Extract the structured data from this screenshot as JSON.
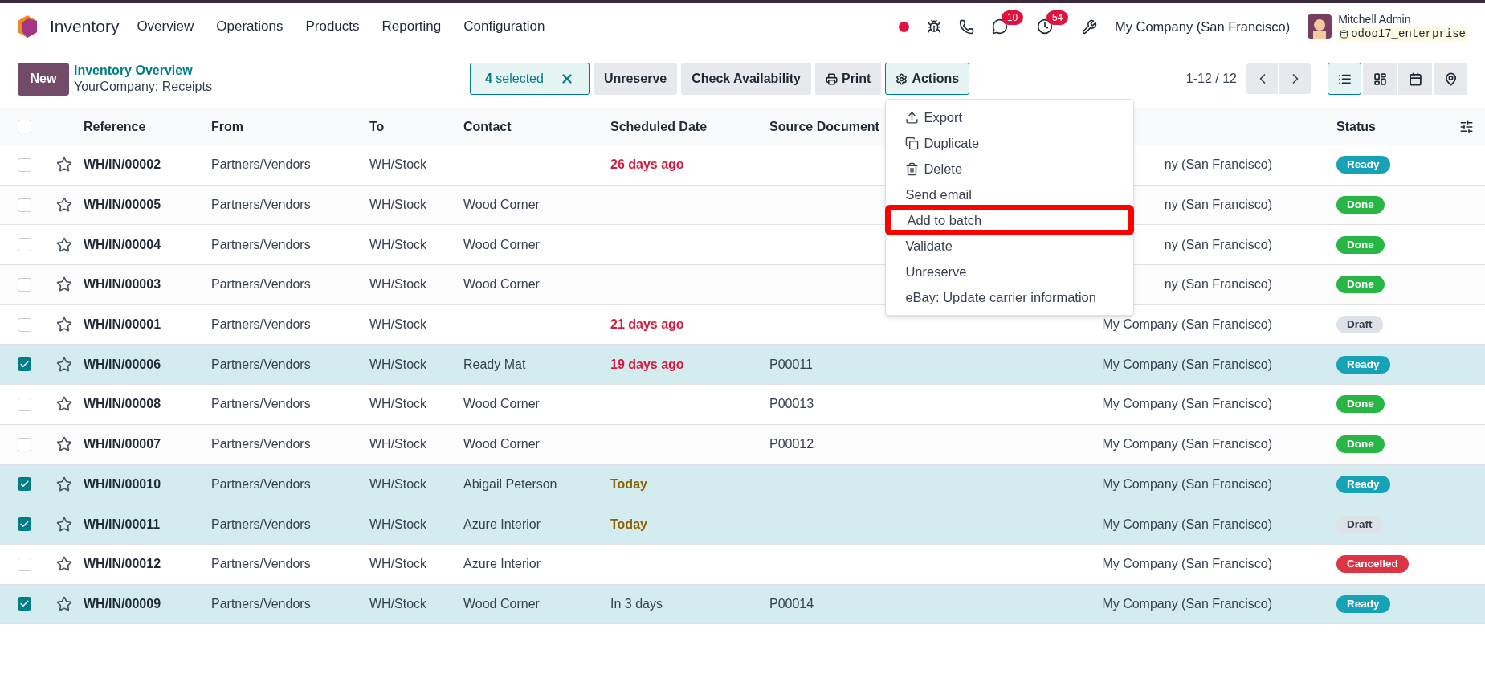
{
  "navbar": {
    "app": "Inventory",
    "menu": [
      "Overview",
      "Operations",
      "Products",
      "Reporting",
      "Configuration"
    ],
    "chat_count": "10",
    "activity_count": "54",
    "company": "My Company (San Francisco)",
    "user": "Mitchell Admin",
    "database": "odoo17_enterprise"
  },
  "control_panel": {
    "new_button": "New",
    "breadcrumb": "Inventory Overview",
    "title": "YourCompany: Receipts",
    "selection_count": "4",
    "selection_label": "selected",
    "buttons": [
      "Unreserve",
      "Check Availability"
    ],
    "print": "Print",
    "actions": "Actions",
    "pager": "1-12 / 12",
    "views": [
      {
        "kind": "list",
        "selected": true
      },
      {
        "kind": "kanban",
        "selected": false
      },
      {
        "kind": "calendar",
        "selected": false
      },
      {
        "kind": "map",
        "selected": false
      }
    ]
  },
  "actions_menu": [
    {
      "label": "Export",
      "highlighted": false
    },
    {
      "label": "Duplicate",
      "highlighted": false
    },
    {
      "label": "Delete",
      "highlighted": false
    },
    {
      "label": "Send email",
      "highlighted": false
    },
    {
      "label": "Add to batch",
      "highlighted": true
    },
    {
      "label": "Validate",
      "highlighted": false
    },
    {
      "label": "Unreserve",
      "highlighted": false
    },
    {
      "label": "eBay: Update carrier information",
      "highlighted": false
    }
  ],
  "table": {
    "all_selected": false,
    "columns": [
      "Reference",
      "From",
      "To",
      "Contact",
      "Scheduled Date",
      "Source Document",
      "Status"
    ],
    "rows": [
      {
        "checked": false,
        "reference": "WH/IN/00002",
        "from": "Partners/Vendors",
        "to": "WH/Stock",
        "scheduled": "26 days ago",
        "overdue": true,
        "company": "ny (San Francisco)",
        "status": "Ready",
        "color": "#17a2b8"
      },
      {
        "checked": false,
        "reference": "WH/IN/00005",
        "from": "Partners/Vendors",
        "to": "WH/Stock",
        "contact": "Wood Corner",
        "company": "ny (San Francisco)",
        "status": "Done",
        "color": "#28b745"
      },
      {
        "checked": false,
        "reference": "WH/IN/00004",
        "from": "Partners/Vendors",
        "to": "WH/Stock",
        "contact": "Wood Corner",
        "company": "ny (San Francisco)",
        "status": "Done",
        "color": "#28b745"
      },
      {
        "checked": false,
        "reference": "WH/IN/00003",
        "from": "Partners/Vendors",
        "to": "WH/Stock",
        "contact": "Wood Corner",
        "company": "ny (San Francisco)",
        "status": "Done",
        "color": "#28b745"
      },
      {
        "checked": false,
        "reference": "WH/IN/00001",
        "from": "Partners/Vendors",
        "to": "WH/Stock",
        "scheduled": "21 days ago",
        "overdue": true,
        "company": "My Company (San Francisco)",
        "status": "Draft",
        "color": "#dee2e6"
      },
      {
        "checked": true,
        "reference": "WH/IN/00006",
        "from": "Partners/Vendors",
        "to": "WH/Stock",
        "contact": "Ready Mat",
        "scheduled": "19 days ago",
        "overdue": true,
        "source": "P00011",
        "company": "My Company (San Francisco)",
        "status": "Ready",
        "color": "#17a2b8"
      },
      {
        "checked": false,
        "reference": "WH/IN/00008",
        "from": "Partners/Vendors",
        "to": "WH/Stock",
        "contact": "Wood Corner",
        "source": "P00013",
        "company": "My Company (San Francisco)",
        "status": "Done",
        "color": "#28b745"
      },
      {
        "checked": false,
        "reference": "WH/IN/00007",
        "from": "Partners/Vendors",
        "to": "WH/Stock",
        "contact": "Wood Corner",
        "source": "P00012",
        "company": "My Company (San Francisco)",
        "status": "Done",
        "color": "#28b745"
      },
      {
        "checked": true,
        "reference": "WH/IN/00010",
        "from": "Partners/Vendors",
        "to": "WH/Stock",
        "contact": "Abigail Peterson",
        "scheduled": "Today",
        "overdue": false,
        "due_today": true,
        "company": "My Company (San Francisco)",
        "status": "Ready",
        "color": "#17a2b8"
      },
      {
        "checked": true,
        "reference": "WH/IN/00011",
        "from": "Partners/Vendors",
        "to": "WH/Stock",
        "contact": "Azure Interior",
        "scheduled": "Today",
        "overdue": false,
        "due_today": true,
        "company": "My Company (San Francisco)",
        "status": "Draft",
        "color": "#dee2e6"
      },
      {
        "checked": false,
        "reference": "WH/IN/00012",
        "from": "Partners/Vendors",
        "to": "WH/Stock",
        "contact": "Azure Interior",
        "company": "My Company (San Francisco)",
        "status": "Cancelled",
        "color": "#dc3545"
      },
      {
        "checked": true,
        "reference": "WH/IN/00009",
        "from": "Partners/Vendors",
        "to": "WH/Stock",
        "contact": "Wood Corner",
        "scheduled": "In 3 days",
        "overdue": false,
        "due_today": false,
        "source": "P00014",
        "company": "My Company (San Francisco)",
        "status": "Ready",
        "color": "#17a2b8"
      }
    ]
  }
}
